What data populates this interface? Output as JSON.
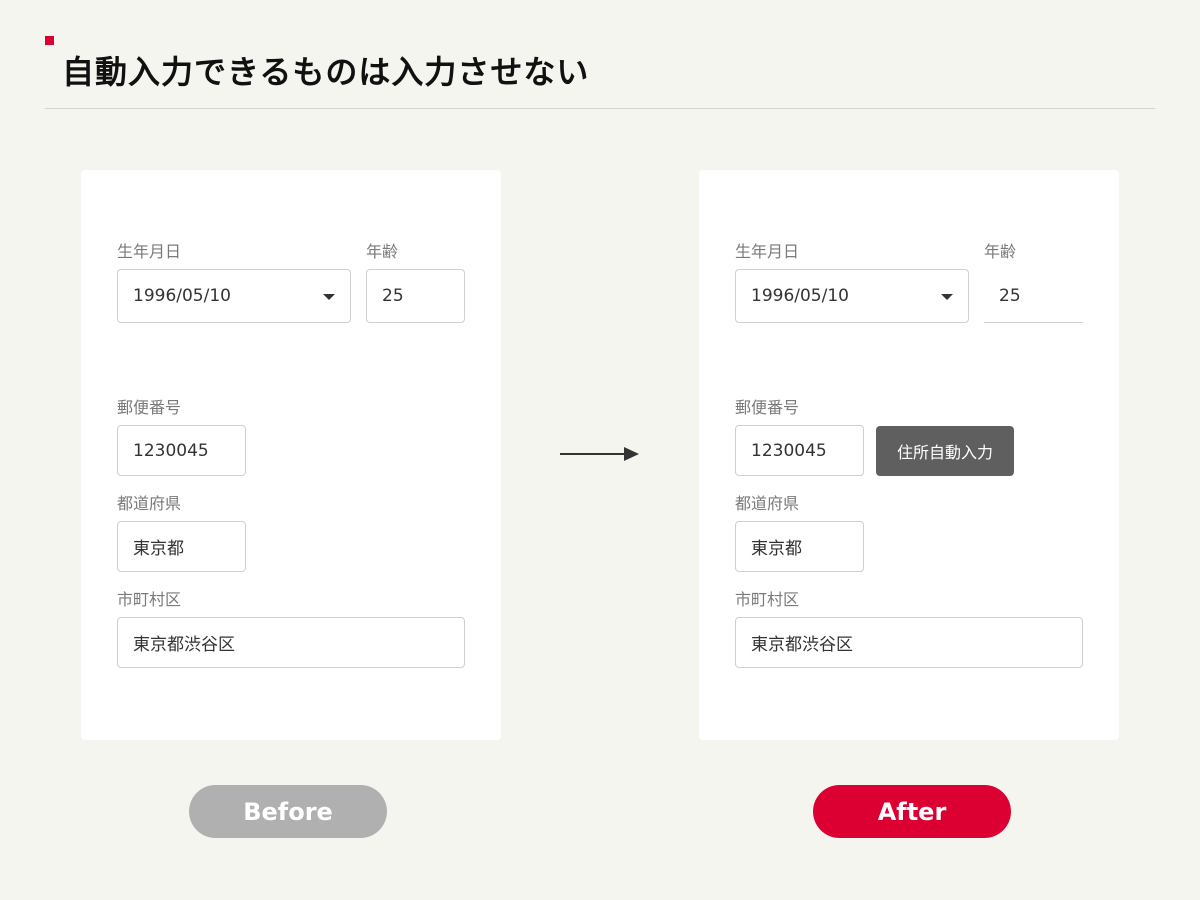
{
  "title": "自動入力できるものは入力させない",
  "before": {
    "birth_label": "生年月日",
    "birth_value": "1996/05/10",
    "age_label": "年齢",
    "age_value": "25",
    "postal_label": "郵便番号",
    "postal_value": "1230045",
    "pref_label": "都道府県",
    "pref_value": "東京都",
    "city_label": "市町村区",
    "city_value": "東京都渋谷区"
  },
  "after": {
    "birth_label": "生年月日",
    "birth_value": "1996/05/10",
    "age_label": "年齢",
    "age_value": "25",
    "postal_label": "郵便番号",
    "postal_value": "1230045",
    "autofill_button": "住所自動入力",
    "pref_label": "都道府県",
    "pref_value": "東京都",
    "city_label": "市町村区",
    "city_value": "東京都渋谷区"
  },
  "labels": {
    "before": "Before",
    "after": "After"
  },
  "colors": {
    "accent": "#dc0032",
    "before_pill": "#b0b0b0",
    "autofill_button": "#5f5f5f",
    "background": "#f5f5f0"
  },
  "icons": {
    "dropdown": "chevron-down-icon",
    "arrow": "arrow-right-icon"
  }
}
